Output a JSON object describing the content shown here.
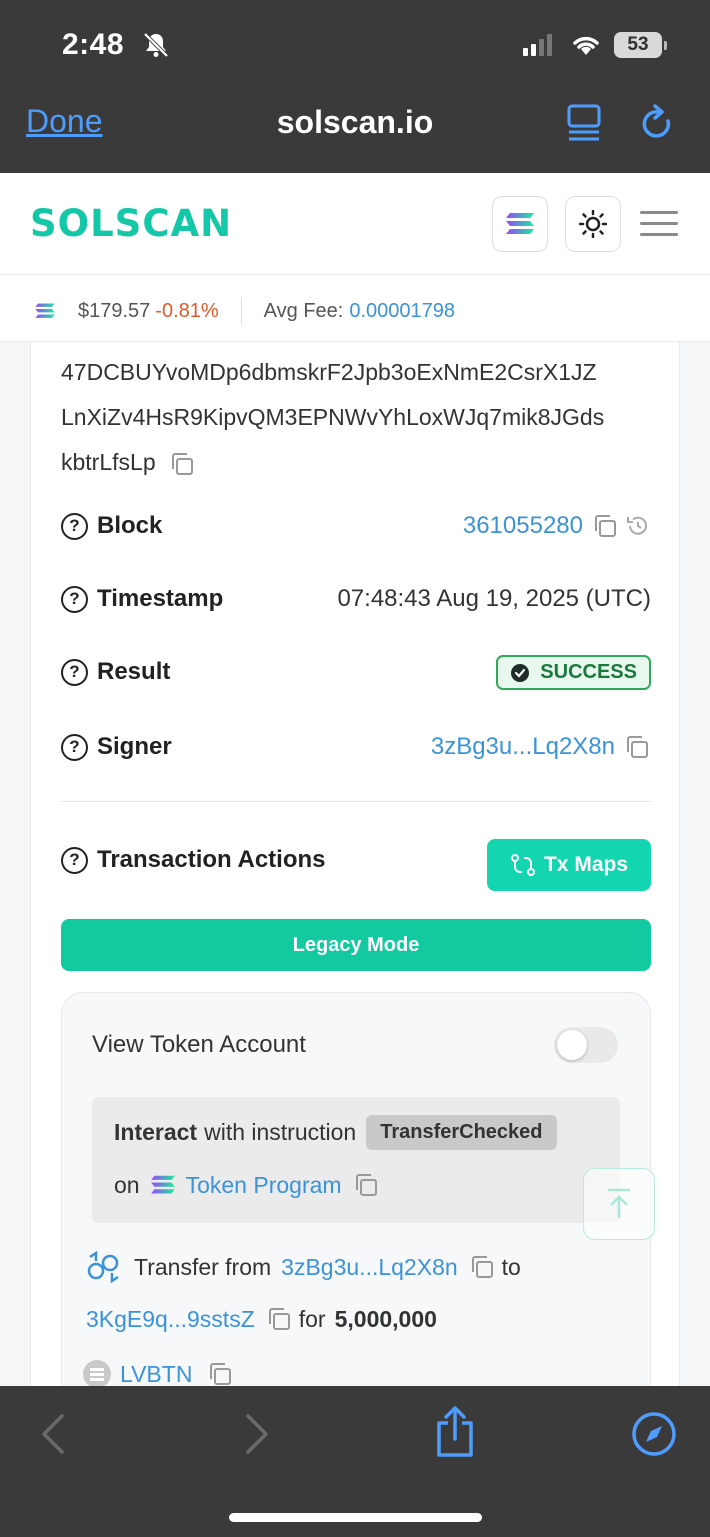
{
  "status_bar": {
    "time": "2:48",
    "battery": "53"
  },
  "browser": {
    "done_label": "Done",
    "site": "solscan.io"
  },
  "header": {
    "logo_text": "SOLSCAN"
  },
  "price_bar": {
    "price": "$179.57",
    "change": "-0.81%",
    "fee_label": "Avg Fee:",
    "fee_value": "0.00001798"
  },
  "signature": {
    "line1": "47DCBUYvoMDp6dbmskrF2Jpb3oExNmE2CsrX1JZ",
    "line2": "LnXiZv4HsR9KipvQM3EPNWvYhLoxWJq7mik8JGds",
    "line3": "kbtrLfsLp"
  },
  "details": {
    "block_label": "Block",
    "block_value": "361055280",
    "timestamp_label": "Timestamp",
    "timestamp_value": "07:48:43 Aug 19, 2025 (UTC)",
    "result_label": "Result",
    "result_value": "SUCCESS",
    "signer_label": "Signer",
    "signer_value": "3zBg3u...Lq2X8n"
  },
  "actions": {
    "title": "Transaction Actions",
    "tx_maps_label": "Tx Maps",
    "legacy_label": "Legacy Mode",
    "view_token_label": "View Token Account",
    "interact_bold": "Interact",
    "interact_text": "with instruction",
    "instruction_tag": "TransferChecked",
    "on_text": "on",
    "program_name": "Token Program",
    "transfer_from_text": "Transfer from",
    "from_addr": "3zBg3u...Lq2X8n",
    "to_text": "to",
    "to_addr": "3KgE9q...9sstsZ",
    "for_text": "for",
    "amount": "5,000,000",
    "token_name": "LVBTN"
  },
  "colors": {
    "brand": "#13c7a7",
    "link": "#3a93d8",
    "negative": "#e05a2b",
    "success": "#2eaa5a"
  }
}
